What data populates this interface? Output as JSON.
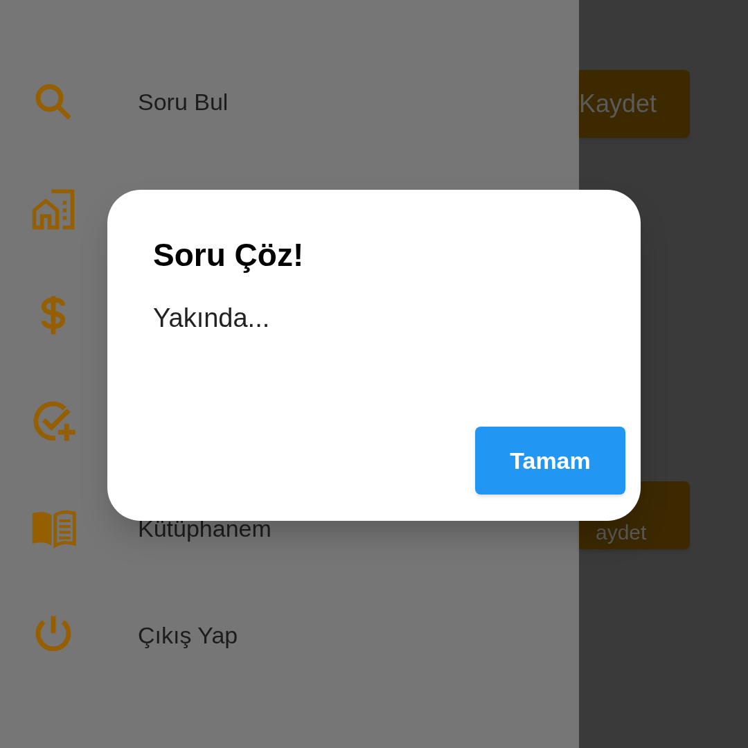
{
  "drawer": {
    "items": [
      {
        "kind": "search",
        "label": "Soru Bul"
      },
      {
        "kind": "buildings"
      },
      {
        "kind": "dollar"
      },
      {
        "kind": "check-plus"
      },
      {
        "kind": "book",
        "label": "Kütüphanem"
      },
      {
        "kind": "power",
        "label": "Çıkış Yap"
      }
    ]
  },
  "background_buttons": [
    "Kaydet",
    "aydet"
  ],
  "dialog": {
    "title": "Soru Çöz!",
    "message": "Yakında...",
    "button": "Tamam"
  }
}
